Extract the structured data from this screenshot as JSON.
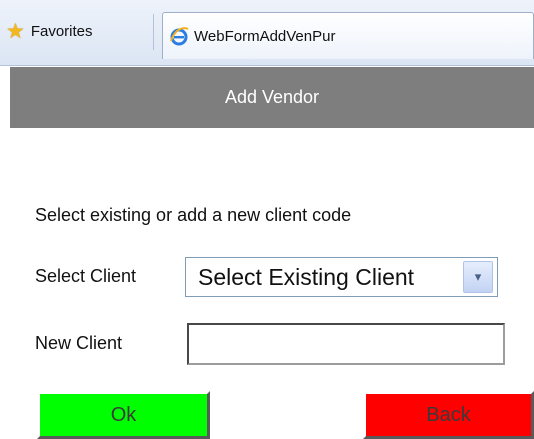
{
  "browser": {
    "favorites_label": "Favorites",
    "tab_title": "WebFormAddVenPur"
  },
  "header": {
    "title": "Add Vendor"
  },
  "form": {
    "instruction": "Select existing or add a new client code",
    "select_client_label": "Select Client",
    "select_client_value": "Select Existing Client",
    "new_client_label": "New Client",
    "new_client_value": ""
  },
  "buttons": {
    "ok_label": "Ok",
    "back_label": "Back"
  },
  "colors": {
    "header_bg": "#7e7e7e",
    "ok_bg": "#00ff00",
    "back_bg": "#ff0000"
  },
  "icons": {
    "favorites": "star-icon",
    "tab": "internet-explorer-icon",
    "dropdown": "chevron-down-icon"
  }
}
